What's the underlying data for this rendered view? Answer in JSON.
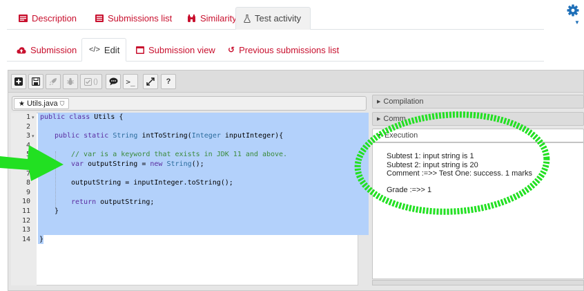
{
  "top_tabs": [
    {
      "label": "Description",
      "icon": "description-icon"
    },
    {
      "label": "Submissions list",
      "icon": "list-icon"
    },
    {
      "label": "Similarity",
      "icon": "binoculars-icon"
    },
    {
      "label": "Test activity",
      "icon": "flask-icon"
    }
  ],
  "sub_tabs": [
    {
      "label": "Submission",
      "icon": "cloud-upload-icon"
    },
    {
      "label": "Edit",
      "icon": "code-icon"
    },
    {
      "label": "Submission view",
      "icon": "view-icon"
    },
    {
      "label": "Previous submissions list",
      "icon": "history-icon"
    }
  ],
  "toolbar": {
    "buttons": [
      "new-file",
      "save",
      "run",
      "debug",
      "evaluate",
      "comments",
      "console",
      "fullscreen",
      "help"
    ],
    "evaluate_label": "()",
    "help_label": "?"
  },
  "file_tab": {
    "name": "Utils.java"
  },
  "code_lines": [
    {
      "n": "1",
      "fold": true
    },
    {
      "n": "2"
    },
    {
      "n": "3",
      "fold": true
    },
    {
      "n": "4"
    },
    {
      "n": "5"
    },
    {
      "n": "6"
    },
    {
      "n": "7"
    },
    {
      "n": "8"
    },
    {
      "n": "9"
    },
    {
      "n": "10"
    },
    {
      "n": "11"
    },
    {
      "n": "12"
    },
    {
      "n": "13"
    },
    {
      "n": "14"
    }
  ],
  "code": {
    "l1_kw": "public class",
    "l1_rest": " Utils {",
    "l3_kw": "public static",
    "l3_ty1": "String",
    "l3_mid": " intToString(",
    "l3_ty2": "Integer",
    "l3_rest": " inputInteger){",
    "l5_comment": "// var is a keyword that exists in JDK 11 and above.",
    "l6_kw": "var",
    "l6_mid": " outputString = ",
    "l6_kw2": "new",
    "l6_ty": "String",
    "l6_rest": "();",
    "l8": "outputString = inputInteger.toString();",
    "l10_kw": "return",
    "l10_rest": " outputString;",
    "l11": "}",
    "l14": "}"
  },
  "panels": {
    "compilation": "Compilation",
    "comments": "Comm",
    "execution": "Execution"
  },
  "execution_output": [
    "Subtest 1: input string is 1",
    "Subtest 2: input string is 20",
    "Comment :=>> Test One: success. 1 marks",
    "",
    "Grade :=>> 1"
  ],
  "colors": {
    "accent": "#c8102e",
    "selection": "#b3d1fb",
    "annotation": "#22e022",
    "gear": "#1e6fb8"
  }
}
